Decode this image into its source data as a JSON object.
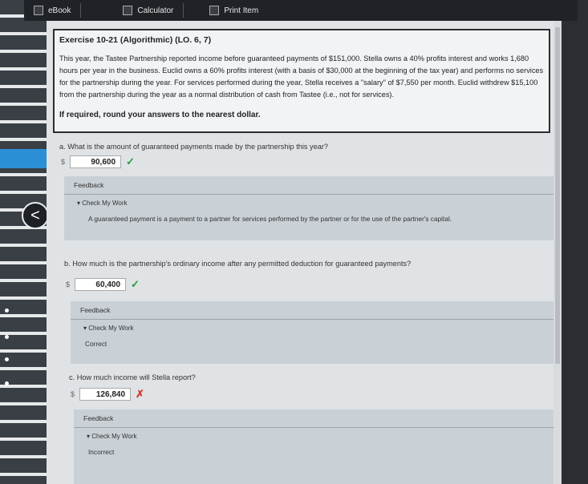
{
  "toolbar": {
    "ebook": "eBook",
    "calculator": "Calculator",
    "print": "Print Item"
  },
  "exercise": {
    "title": "Exercise 10-21 (Algorithmic) (LO. 6, 7)",
    "body": "This year, the Tastee Partnership reported income before guaranteed payments of $151,000. Stella owns a 40% profits interest and works 1,680 hours per year in the business. Euclid owns a 60% profits interest (with a basis of $30,000 at the beginning of the tax year) and performs no services for the partnership during the year. For services performed during the year, Stella receives a \"salary\" of $7,550 per month. Euclid withdrew $15,100 from the partnership during the year as a normal distribution of cash from Tastee (i.e., not for services).",
    "note": "If required, round your answers to the nearest dollar."
  },
  "questions": [
    {
      "text": "a.  What is the amount of guaranteed payments made by the partnership this year?",
      "currency": "$",
      "answer": "90,600",
      "mark": "✓",
      "feedback_label": "Feedback",
      "check_label": "▾ Check My Work",
      "feedback_text": "A guaranteed payment is a payment to a partner for services performed by the partner or for the use of the partner's capital."
    },
    {
      "text": "b.  How much is the partnership's ordinary income after any permitted deduction for guaranteed payments?",
      "currency": "$",
      "answer": "60,400",
      "mark": "✓",
      "feedback_label": "Feedback",
      "check_label": "▾ Check My Work",
      "feedback_text": "Correct"
    },
    {
      "text": "c.  How much income will Stella report?",
      "currency": "$",
      "answer": "126,840",
      "mark": "✗",
      "feedback_label": "Feedback",
      "check_label": "▾ Check My Work",
      "feedback_text": "Incorrect"
    }
  ],
  "nav": {
    "back_glyph": "<"
  }
}
